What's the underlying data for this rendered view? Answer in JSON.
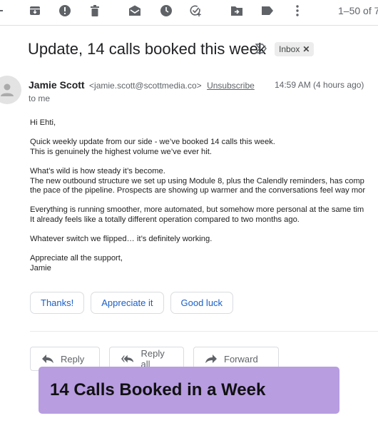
{
  "toolbar": {
    "icons": [
      "archive-icon",
      "report-spam-icon",
      "delete-icon",
      "mark-unread-icon",
      "snooze-icon",
      "add-task-icon",
      "move-to-icon",
      "label-icon",
      "more-options-icon"
    ],
    "page_range": "1–50 of 7"
  },
  "email": {
    "subject": "Update, 14 calls booked this week",
    "label_chip": "Inbox",
    "sender_name": "Jamie Scott",
    "sender_email": "<jamie.scott@scottmedia.co>",
    "unsubscribe": "Unsubscribe",
    "recipient": "to me",
    "timestamp": "14:59 AM (4 hours ago)",
    "body": {
      "greeting": "Hi Ehti,",
      "p1_l1": "Quick weekly update from our side - we’ve booked 14 calls this week.",
      "p1_l2": "This is genuinely the highest volume we’ve ever hit.",
      "p2_l1": "What’s wild is how steady it’s become.",
      "p2_l2": "The new outbound structure we  set up using Module 8, plus the Calendly reminders, has comp",
      "p2_l3": "the pace of the pipeline. Prospects are showing up warmer and the conversations feel way mor",
      "p3_l1": "Everything is running smoother, more automated, but somehow more personal at the same tim",
      "p3_l2": "It already feels like a totally different operation compared to two months ago.",
      "p4_l1": "Whatever switch we flipped… it’s definitely working.",
      "signoff": "Appreciate all the support,",
      "signature": "Jamie"
    }
  },
  "smart_replies": [
    "Thanks!",
    "Appreciate it",
    "Good luck"
  ],
  "actions": {
    "reply": "Reply",
    "reply_all": "Reply all",
    "forward": "Forward"
  },
  "caption": "14 Calls Booked in a Week",
  "colors": {
    "link_blue": "#1a5fc7",
    "caption_bg": "#b89de1",
    "icon_gray": "#5f6368"
  }
}
